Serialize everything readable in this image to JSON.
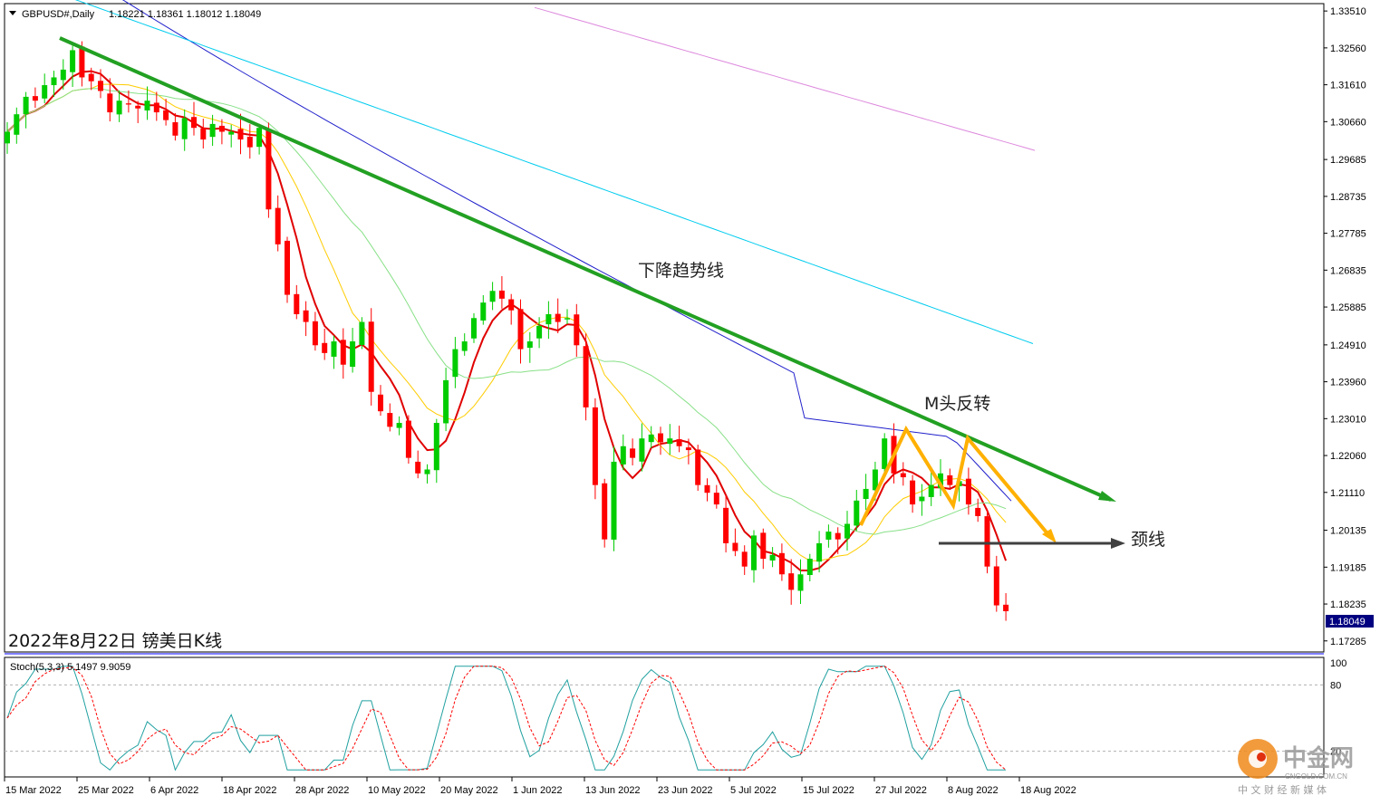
{
  "header": {
    "symbol": "GBPUSD#,Daily",
    "ohlc": "1.18221 1.18361 1.18012 1.18049"
  },
  "stoch_header": "Stoch(5,3,3) 5.1497 9.9059",
  "caption": "2022年8月22日 镑美日K线",
  "annotations": {
    "trendline": "下降趋势线",
    "mtop": "M头反转",
    "neckline": "颈线"
  },
  "current_price": "1.18049",
  "watermark": {
    "cn": "中金网",
    "url": "CNGOLD.COM.CN",
    "tagline": "中 文 财 经 新 媒 体"
  },
  "colors": {
    "bull": "#00cc00",
    "bear": "#ff0000",
    "ma5": "#e00000",
    "ma10": "#ffcc00",
    "ma20": "#88e088",
    "ma60": "#2020cc",
    "ma120": "#00ccee",
    "ma250": "#dd88dd",
    "trendline": "#22a022",
    "mtop": "#ffb000",
    "neck": "#404040",
    "stoch_main": "#20a0a0",
    "stoch_signal": "#ff0000"
  },
  "chart_data": {
    "type": "candlestick",
    "symbol": "GBPUSD",
    "timeframe": "Daily",
    "ylim": [
      1.17,
      1.337
    ],
    "y_ticks": [
      "1.33510",
      "1.32560",
      "1.31610",
      "1.30660",
      "1.29685",
      "1.28735",
      "1.27785",
      "1.26835",
      "1.25885",
      "1.24910",
      "1.23960",
      "1.23010",
      "1.22060",
      "1.21110",
      "1.20135",
      "1.19185",
      "1.18235",
      "1.17285"
    ],
    "x_ticks": [
      "15 Mar 2022",
      "25 Mar 2022",
      "6 Apr 2022",
      "18 Apr 2022",
      "28 Apr 2022",
      "10 May 2022",
      "20 May 2022",
      "1 Jun 2022",
      "13 Jun 2022",
      "23 Jun 2022",
      "5 Jul 2022",
      "15 Jul 2022",
      "27 Jul 2022",
      "8 Aug 2022",
      "18 Aug 2022"
    ],
    "closes": [
      1.304,
      1.3085,
      1.313,
      1.312,
      1.316,
      1.318,
      1.32,
      1.325,
      1.318,
      1.317,
      1.3145,
      1.309,
      1.312,
      1.311,
      1.31,
      1.312,
      1.309,
      1.307,
      1.303,
      1.3075,
      1.305,
      1.302,
      1.306,
      1.304,
      1.304,
      1.302,
      1.3,
      1.305,
      1.284,
      1.275,
      1.262,
      1.257,
      1.255,
      1.249,
      1.247,
      1.25,
      1.244,
      1.25,
      1.255,
      1.237,
      1.232,
      1.228,
      1.229,
      1.22,
      1.216,
      1.217,
      1.229,
      1.24,
      1.248,
      1.25,
      1.256,
      1.26,
      1.263,
      1.261,
      1.258,
      1.248,
      1.25,
      1.254,
      1.257,
      1.255,
      1.256,
      1.249,
      1.233,
      1.213,
      1.199,
      1.219,
      1.223,
      1.22,
      1.225,
      1.226,
      1.224,
      1.225,
      1.223,
      1.222,
      1.213,
      1.211,
      1.208,
      1.198,
      1.196,
      1.192,
      1.2,
      1.194,
      1.195,
      1.19,
      1.186,
      1.19,
      1.194,
      1.198,
      1.201,
      1.199,
      1.203,
      1.209,
      1.212,
      1.217,
      1.225,
      1.216,
      1.215,
      1.208,
      1.21,
      1.213,
      1.216,
      1.213,
      1.214,
      1.208,
      1.205,
      1.192,
      1.182,
      1.1805
    ],
    "ma_periods": [
      5,
      10,
      20,
      60,
      120,
      250
    ],
    "stoch_levels": [
      20,
      80
    ],
    "stoch_ylim": [
      0,
      100
    ],
    "stoch_last": {
      "main": 5.1497,
      "signal": 9.9059
    }
  }
}
